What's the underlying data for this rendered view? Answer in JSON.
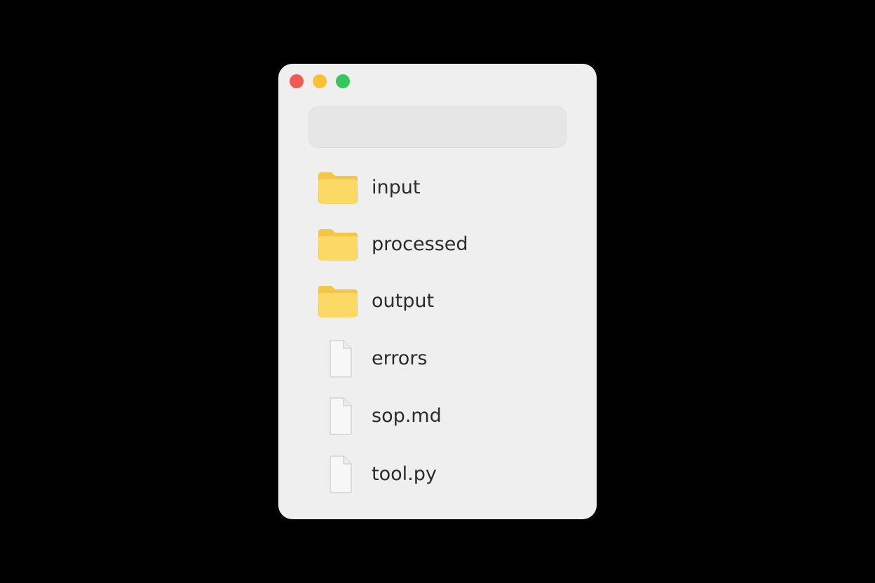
{
  "window": {
    "traffic_lights": {
      "close_color": "#f05b52",
      "minimize_color": "#f7c236",
      "zoom_color": "#35c759"
    }
  },
  "search": {
    "value": "",
    "placeholder": ""
  },
  "colors": {
    "folder_front": "#fcd965",
    "folder_back": "#f6c94e",
    "file_page": "#f7f7f7",
    "file_border": "#d3d3d3"
  },
  "files": [
    {
      "name": "input",
      "kind": "folder",
      "icon": "folder-icon"
    },
    {
      "name": "processed",
      "kind": "folder",
      "icon": "folder-icon"
    },
    {
      "name": "output",
      "kind": "folder",
      "icon": "folder-icon"
    },
    {
      "name": "errors",
      "kind": "file",
      "icon": "document-icon"
    },
    {
      "name": "sop.md",
      "kind": "file",
      "icon": "document-icon"
    },
    {
      "name": "tool.py",
      "kind": "file",
      "icon": "document-icon"
    }
  ]
}
